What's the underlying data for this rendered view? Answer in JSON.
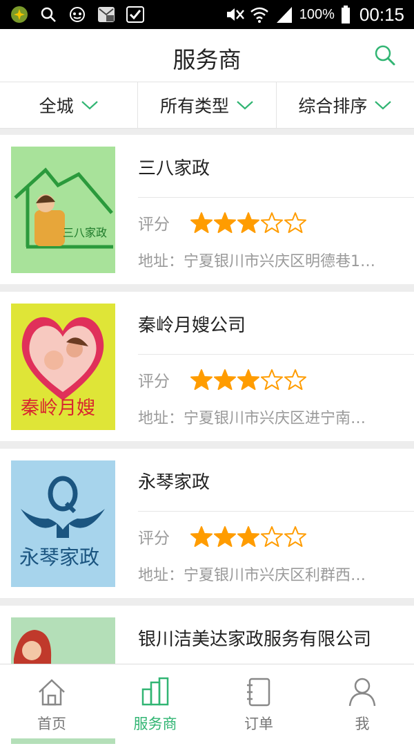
{
  "statusbar": {
    "battery_pct": "100%",
    "time": "00:15"
  },
  "header": {
    "title": "服务商"
  },
  "filters": [
    {
      "label": "全城"
    },
    {
      "label": "所有类型"
    },
    {
      "label": "综合排序"
    }
  ],
  "providers": [
    {
      "name": "三八家政",
      "rating_label": "评分",
      "rating": 3,
      "address": "地址：宁夏银川市兴庆区明德巷1…",
      "logo_text": "三八家政"
    },
    {
      "name": "秦岭月嫂公司",
      "rating_label": "评分",
      "rating": 3,
      "address": "地址：宁夏银川市兴庆区进宁南…",
      "logo_text": "秦岭月嫂"
    },
    {
      "name": "永琴家政",
      "rating_label": "评分",
      "rating": 3,
      "address": "地址：宁夏银川市兴庆区利群西…",
      "logo_text": "永琴家政"
    },
    {
      "name": "银川洁美达家政服务有限公司"
    }
  ],
  "tabs": [
    {
      "label": "首页",
      "icon": "home-icon"
    },
    {
      "label": "服务商",
      "icon": "buildings-icon"
    },
    {
      "label": "订单",
      "icon": "notebook-icon"
    },
    {
      "label": "我",
      "icon": "person-icon"
    }
  ],
  "colors": {
    "accent": "#31b573",
    "star": "#ff9c00"
  }
}
